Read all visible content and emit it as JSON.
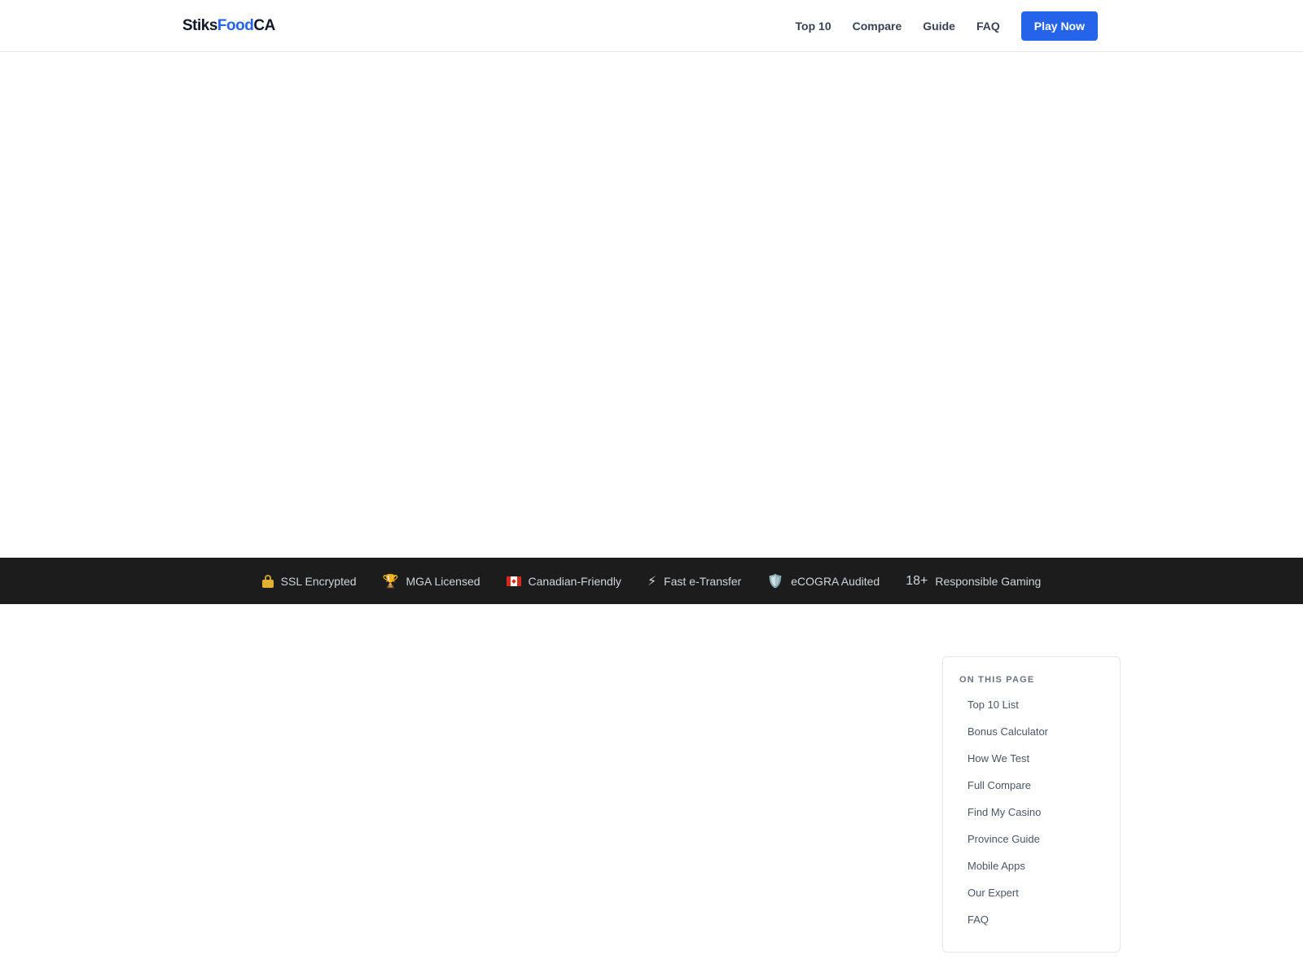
{
  "header": {
    "logo": {
      "part1": "Stiks",
      "part2": "Food",
      "part3": "CA"
    },
    "nav": [
      {
        "label": "Top 10"
      },
      {
        "label": "Compare"
      },
      {
        "label": "Guide"
      },
      {
        "label": "FAQ"
      }
    ],
    "cta_label": "Play Now"
  },
  "trust_bar": {
    "items": [
      {
        "icon": "lock-icon",
        "label": "SSL Encrypted"
      },
      {
        "icon": "trophy-icon",
        "icon_glyph": "🏆",
        "label": "MGA Licensed"
      },
      {
        "icon": "canada-flag-icon",
        "label": "Canadian-Friendly"
      },
      {
        "icon": "lightning-icon",
        "icon_glyph": "⚡",
        "label": "Fast e-Transfer"
      },
      {
        "icon": "shield-icon",
        "icon_glyph": "🛡️",
        "label": "eCOGRA Audited"
      },
      {
        "icon": "age-18-icon",
        "icon_glyph": "18+",
        "label": "Responsible Gaming"
      }
    ]
  },
  "toc": {
    "title": "ON THIS PAGE",
    "items": [
      {
        "label": "Top 10 List"
      },
      {
        "label": "Bonus Calculator"
      },
      {
        "label": "How We Test"
      },
      {
        "label": "Full Compare"
      },
      {
        "label": "Find My Casino"
      },
      {
        "label": "Province Guide"
      },
      {
        "label": "Mobile Apps"
      },
      {
        "label": "Our Expert"
      },
      {
        "label": "FAQ"
      }
    ]
  },
  "colors": {
    "accent": "#2563eb",
    "trust_bar_bg": "#1c1c1c",
    "border": "#e5e7eb"
  }
}
